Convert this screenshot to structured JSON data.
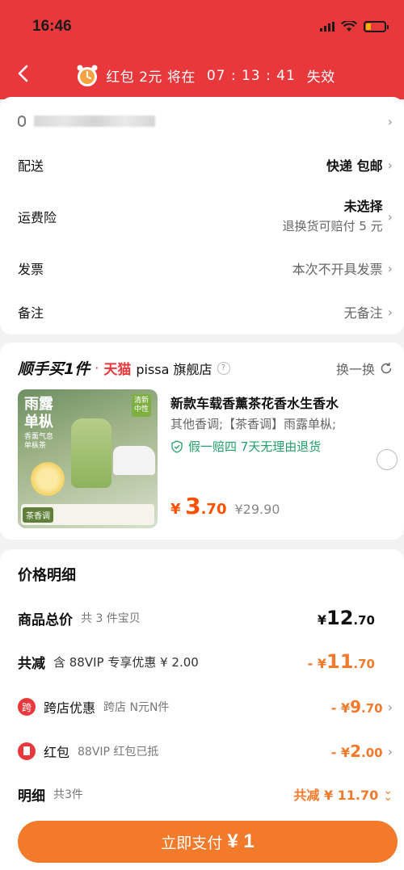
{
  "status_bar": {
    "time": "16:46"
  },
  "nav": {
    "timer_prefix": "红包 2元 将在",
    "timer_count": "07 : 13 : 41",
    "timer_suffix": "失效"
  },
  "order_info": {
    "address_label": "",
    "delivery_label": "配送",
    "delivery_value": "快递 包邮",
    "insurance_label": "运费险",
    "insurance_value": "未选择",
    "insurance_note": "退换货可赔付 5 元",
    "invoice_label": "发票",
    "invoice_value": "本次不开具发票",
    "remark_label": "备注",
    "remark_value": "无备注"
  },
  "store": {
    "brand": "顺手买1件",
    "dot": "·",
    "tmall": "天猫",
    "name": "pissa 旗舰店",
    "swap_label": "换一换"
  },
  "product": {
    "image_title_1": "雨露",
    "image_title_2": "单枞",
    "image_sub_1": "香薰气息",
    "image_sub_2": "单枞茶",
    "image_tag_1": "清新",
    "image_tag_2": "中性",
    "image_foot_tag": "茶香调",
    "title": "新款车载香薰茶花香水生香水",
    "spec": "其他香调;【茶香调】雨露单枞;",
    "guarantee": "假一赔四  7天无理由退货",
    "price_yen": "¥",
    "price_int": "3",
    "price_dec": ".70",
    "orig_price": "¥29.90"
  },
  "price_detail": {
    "title": "价格明细",
    "goods_total_label": "商品总价",
    "goods_total_sub": "共 3 件宝贝",
    "goods_total_yen": "¥",
    "goods_total_int": "12",
    "goods_total_dec": ".70",
    "reduce_label": "共减",
    "reduce_sub": "含 88VIP 专享优惠 ¥ 2.00",
    "reduce_prefix": "- ¥",
    "reduce_int": "11",
    "reduce_dec": ".70",
    "cross_badge": "跨",
    "cross_label": "跨店优惠",
    "cross_sub": "跨店 N元N件",
    "cross_prefix": "- ¥",
    "cross_int": "9",
    "cross_dec": ".70",
    "hb_label": "红包",
    "hb_sub": "88VIP 红包已抵",
    "hb_prefix": "- ¥",
    "hb_int": "2",
    "hb_dec": ".00",
    "detail_label": "明细",
    "detail_sub": "共3件",
    "detail_total": "共减 ¥ 11.70"
  },
  "pay_button": {
    "label": "立即支付",
    "amount": "¥ 1"
  },
  "colors": {
    "header_red": "#e9383c",
    "accent_orange": "#f27a2b",
    "price_orange": "#ff5000",
    "guarantee_green": "#22a06b"
  }
}
